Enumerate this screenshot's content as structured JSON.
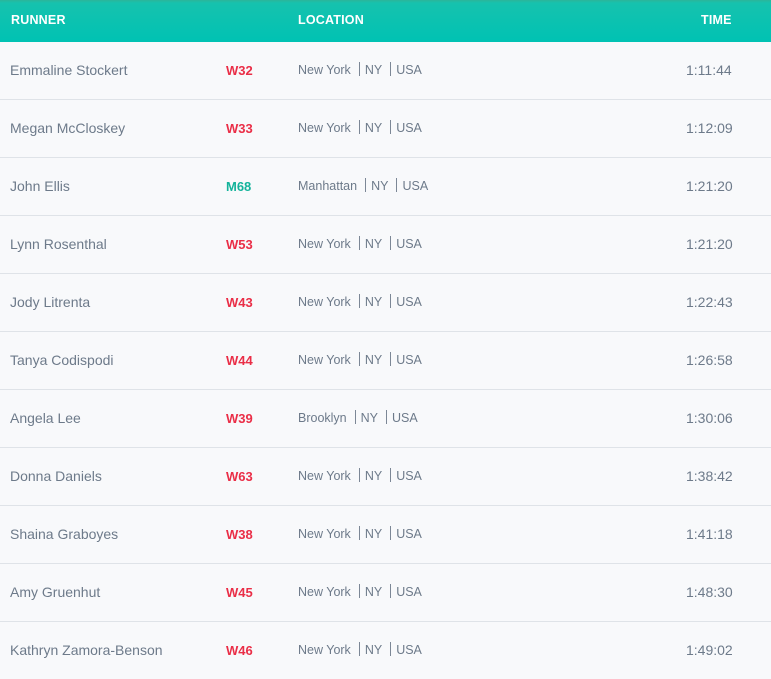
{
  "header": {
    "runner": "RUNNER",
    "location": "LOCATION",
    "time": "TIME"
  },
  "rows": [
    {
      "name": "Emmaline Stockert",
      "division": "W32",
      "sex": "F",
      "city": "New York",
      "state": "NY",
      "country": "USA",
      "time": "1:11:44"
    },
    {
      "name": "Megan McCloskey",
      "division": "W33",
      "sex": "F",
      "city": "New York",
      "state": "NY",
      "country": "USA",
      "time": "1:12:09"
    },
    {
      "name": "John Ellis",
      "division": "M68",
      "sex": "M",
      "city": "Manhattan",
      "state": "NY",
      "country": "USA",
      "time": "1:21:20"
    },
    {
      "name": "Lynn Rosenthal",
      "division": "W53",
      "sex": "F",
      "city": "New York",
      "state": "NY",
      "country": "USA",
      "time": "1:21:20"
    },
    {
      "name": "Jody Litrenta",
      "division": "W43",
      "sex": "F",
      "city": "New York",
      "state": "NY",
      "country": "USA",
      "time": "1:22:43"
    },
    {
      "name": "Tanya Codispodi",
      "division": "W44",
      "sex": "F",
      "city": "New York",
      "state": "NY",
      "country": "USA",
      "time": "1:26:58"
    },
    {
      "name": "Angela Lee",
      "division": "W39",
      "sex": "F",
      "city": "Brooklyn",
      "state": "NY",
      "country": "USA",
      "time": "1:30:06"
    },
    {
      "name": "Donna Daniels",
      "division": "W63",
      "sex": "F",
      "city": "New York",
      "state": "NY",
      "country": "USA",
      "time": "1:38:42"
    },
    {
      "name": "Shaina Graboyes",
      "division": "W38",
      "sex": "F",
      "city": "New York",
      "state": "NY",
      "country": "USA",
      "time": "1:41:18"
    },
    {
      "name": "Amy Gruenhut",
      "division": "W45",
      "sex": "F",
      "city": "New York",
      "state": "NY",
      "country": "USA",
      "time": "1:48:30"
    },
    {
      "name": "Kathryn Zamora-Benson",
      "division": "W46",
      "sex": "F",
      "city": "New York",
      "state": "NY",
      "country": "USA",
      "time": "1:49:02"
    }
  ],
  "colors": {
    "header_bg": "#00c2b3",
    "women_division": "#ea2e47",
    "men_division": "#14b39b",
    "text": "#6d7a8a"
  }
}
